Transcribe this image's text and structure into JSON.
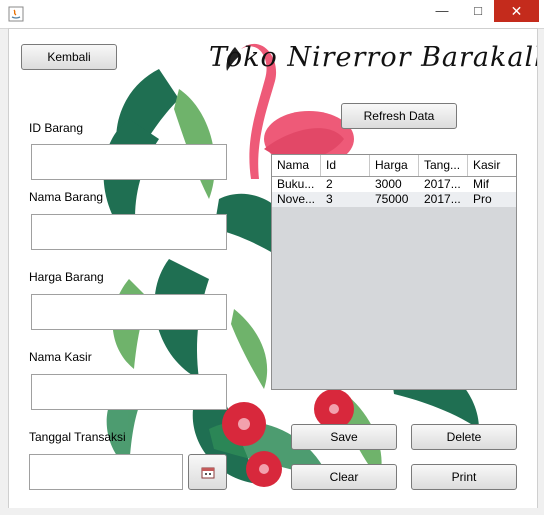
{
  "window": {
    "minimize_icon": "minimize-icon",
    "maximize_icon": "maximize-icon",
    "close_icon": "close-icon",
    "close_glyph": "✕",
    "app_icon": "java-icon"
  },
  "header": {
    "back_label": "Kembali",
    "store_title": "Toko Nirerror Barakallah",
    "refresh_label": "Refresh Data"
  },
  "form": {
    "id_label": "ID Barang",
    "name_label": "Nama Barang",
    "price_label": "Harga Barang",
    "cashier_label": "Nama Kasir",
    "date_label": "Tanggal Transaksi",
    "date_picker_icon": "calendar-icon"
  },
  "table": {
    "columns": [
      "Nama",
      "Id",
      "Harga",
      "Tang...",
      "Kasir"
    ],
    "rows": [
      [
        "Buku...",
        "2",
        "3000",
        "2017...",
        "Mif"
      ],
      [
        "Nove...",
        "3",
        "75000",
        "2017...",
        "Pro"
      ]
    ]
  },
  "actions": {
    "save_label": "Save",
    "delete_label": "Delete",
    "clear_label": "Clear",
    "print_label": "Print"
  },
  "colors": {
    "flamingo": "#ee5a78",
    "leaf_dark": "#1f6f52",
    "leaf_light": "#6fb36b",
    "hibiscus": "#d8283c",
    "close_button": "#c42b1c"
  }
}
